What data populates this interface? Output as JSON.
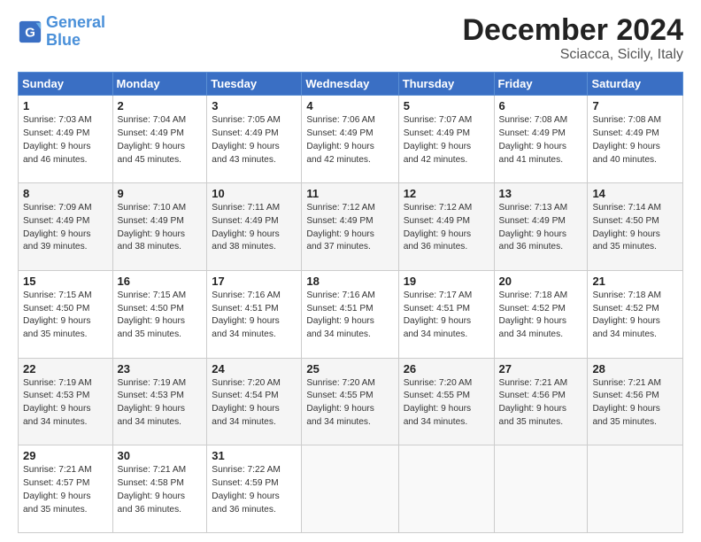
{
  "logo": {
    "line1": "General",
    "line2": "Blue"
  },
  "title": "December 2024",
  "subtitle": "Sciacca, Sicily, Italy",
  "days_of_week": [
    "Sunday",
    "Monday",
    "Tuesday",
    "Wednesday",
    "Thursday",
    "Friday",
    "Saturday"
  ],
  "weeks": [
    [
      {
        "day": "1",
        "info": "Sunrise: 7:03 AM\nSunset: 4:49 PM\nDaylight: 9 hours\nand 46 minutes."
      },
      {
        "day": "2",
        "info": "Sunrise: 7:04 AM\nSunset: 4:49 PM\nDaylight: 9 hours\nand 45 minutes."
      },
      {
        "day": "3",
        "info": "Sunrise: 7:05 AM\nSunset: 4:49 PM\nDaylight: 9 hours\nand 43 minutes."
      },
      {
        "day": "4",
        "info": "Sunrise: 7:06 AM\nSunset: 4:49 PM\nDaylight: 9 hours\nand 42 minutes."
      },
      {
        "day": "5",
        "info": "Sunrise: 7:07 AM\nSunset: 4:49 PM\nDaylight: 9 hours\nand 42 minutes."
      },
      {
        "day": "6",
        "info": "Sunrise: 7:08 AM\nSunset: 4:49 PM\nDaylight: 9 hours\nand 41 minutes."
      },
      {
        "day": "7",
        "info": "Sunrise: 7:08 AM\nSunset: 4:49 PM\nDaylight: 9 hours\nand 40 minutes."
      }
    ],
    [
      {
        "day": "8",
        "info": "Sunrise: 7:09 AM\nSunset: 4:49 PM\nDaylight: 9 hours\nand 39 minutes."
      },
      {
        "day": "9",
        "info": "Sunrise: 7:10 AM\nSunset: 4:49 PM\nDaylight: 9 hours\nand 38 minutes."
      },
      {
        "day": "10",
        "info": "Sunrise: 7:11 AM\nSunset: 4:49 PM\nDaylight: 9 hours\nand 38 minutes."
      },
      {
        "day": "11",
        "info": "Sunrise: 7:12 AM\nSunset: 4:49 PM\nDaylight: 9 hours\nand 37 minutes."
      },
      {
        "day": "12",
        "info": "Sunrise: 7:12 AM\nSunset: 4:49 PM\nDaylight: 9 hours\nand 36 minutes."
      },
      {
        "day": "13",
        "info": "Sunrise: 7:13 AM\nSunset: 4:49 PM\nDaylight: 9 hours\nand 36 minutes."
      },
      {
        "day": "14",
        "info": "Sunrise: 7:14 AM\nSunset: 4:50 PM\nDaylight: 9 hours\nand 35 minutes."
      }
    ],
    [
      {
        "day": "15",
        "info": "Sunrise: 7:15 AM\nSunset: 4:50 PM\nDaylight: 9 hours\nand 35 minutes."
      },
      {
        "day": "16",
        "info": "Sunrise: 7:15 AM\nSunset: 4:50 PM\nDaylight: 9 hours\nand 35 minutes."
      },
      {
        "day": "17",
        "info": "Sunrise: 7:16 AM\nSunset: 4:51 PM\nDaylight: 9 hours\nand 34 minutes."
      },
      {
        "day": "18",
        "info": "Sunrise: 7:16 AM\nSunset: 4:51 PM\nDaylight: 9 hours\nand 34 minutes."
      },
      {
        "day": "19",
        "info": "Sunrise: 7:17 AM\nSunset: 4:51 PM\nDaylight: 9 hours\nand 34 minutes."
      },
      {
        "day": "20",
        "info": "Sunrise: 7:18 AM\nSunset: 4:52 PM\nDaylight: 9 hours\nand 34 minutes."
      },
      {
        "day": "21",
        "info": "Sunrise: 7:18 AM\nSunset: 4:52 PM\nDaylight: 9 hours\nand 34 minutes."
      }
    ],
    [
      {
        "day": "22",
        "info": "Sunrise: 7:19 AM\nSunset: 4:53 PM\nDaylight: 9 hours\nand 34 minutes."
      },
      {
        "day": "23",
        "info": "Sunrise: 7:19 AM\nSunset: 4:53 PM\nDaylight: 9 hours\nand 34 minutes."
      },
      {
        "day": "24",
        "info": "Sunrise: 7:20 AM\nSunset: 4:54 PM\nDaylight: 9 hours\nand 34 minutes."
      },
      {
        "day": "25",
        "info": "Sunrise: 7:20 AM\nSunset: 4:55 PM\nDaylight: 9 hours\nand 34 minutes."
      },
      {
        "day": "26",
        "info": "Sunrise: 7:20 AM\nSunset: 4:55 PM\nDaylight: 9 hours\nand 34 minutes."
      },
      {
        "day": "27",
        "info": "Sunrise: 7:21 AM\nSunset: 4:56 PM\nDaylight: 9 hours\nand 35 minutes."
      },
      {
        "day": "28",
        "info": "Sunrise: 7:21 AM\nSunset: 4:56 PM\nDaylight: 9 hours\nand 35 minutes."
      }
    ],
    [
      {
        "day": "29",
        "info": "Sunrise: 7:21 AM\nSunset: 4:57 PM\nDaylight: 9 hours\nand 35 minutes."
      },
      {
        "day": "30",
        "info": "Sunrise: 7:21 AM\nSunset: 4:58 PM\nDaylight: 9 hours\nand 36 minutes."
      },
      {
        "day": "31",
        "info": "Sunrise: 7:22 AM\nSunset: 4:59 PM\nDaylight: 9 hours\nand 36 minutes."
      },
      null,
      null,
      null,
      null
    ]
  ]
}
